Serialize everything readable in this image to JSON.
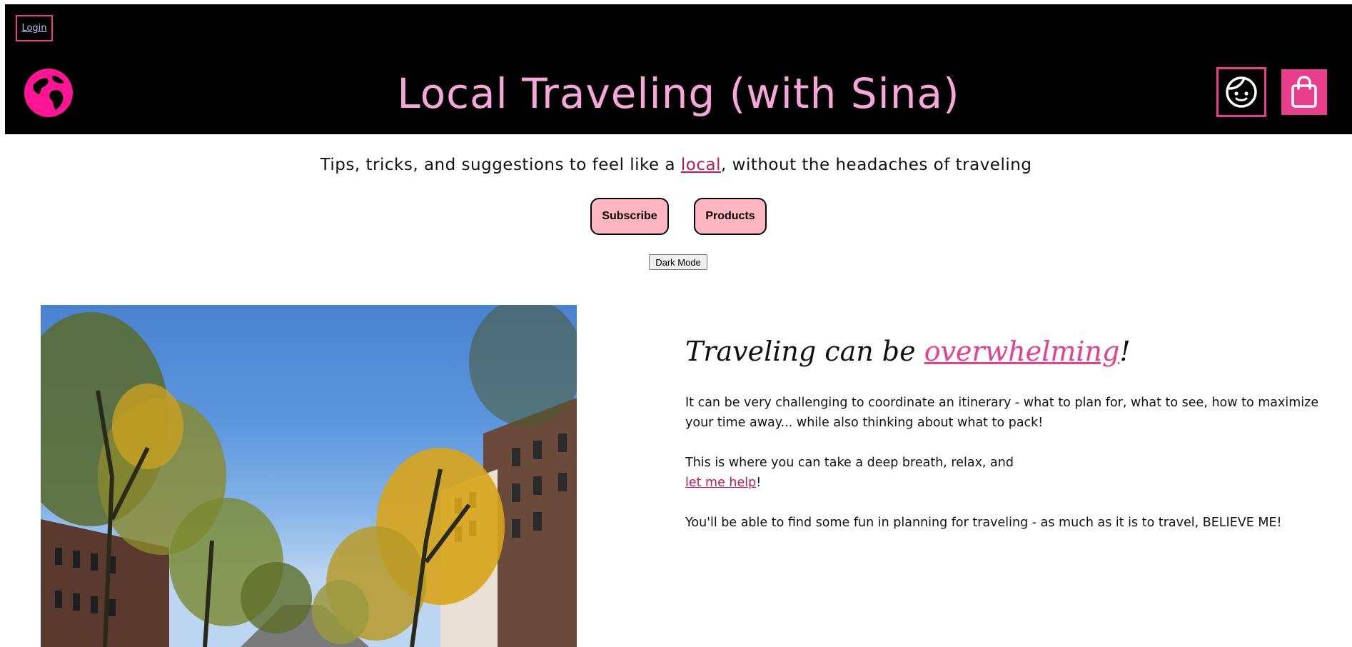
{
  "header": {
    "login_label": "Login",
    "title": "Local Traveling (with Sina)",
    "logo_icon": "globe-icon",
    "profile_icon": "face-icon",
    "cart_icon": "shopping-bag-icon"
  },
  "tagline": {
    "before": "Tips, tricks, and suggestions to feel like a ",
    "link": "local",
    "after": ", without the headaches of traveling"
  },
  "actions": {
    "subscribe_label": "Subscribe",
    "products_label": "Products",
    "dark_mode_label": "Dark Mode"
  },
  "main": {
    "heading_before": "Traveling can be ",
    "heading_link": "overwhelming",
    "heading_after": "!",
    "paragraph1": "It can be very challenging to coordinate an itinerary - what to plan for, what to see, how to maximize your time away... while also thinking about what to pack!",
    "paragraph2_before": "This is where you can take a deep breath, relax, and",
    "paragraph2_link": "let me help",
    "paragraph2_after": "!",
    "paragraph3": "You'll be able to find some fun in planning for traveling - as much as it is to travel, BELIEVE ME!"
  },
  "colors": {
    "accent": "#e83e8c",
    "title_pink": "#f6a6d8",
    "button_pink": "#ffb6c1",
    "header_bg": "#000000"
  }
}
